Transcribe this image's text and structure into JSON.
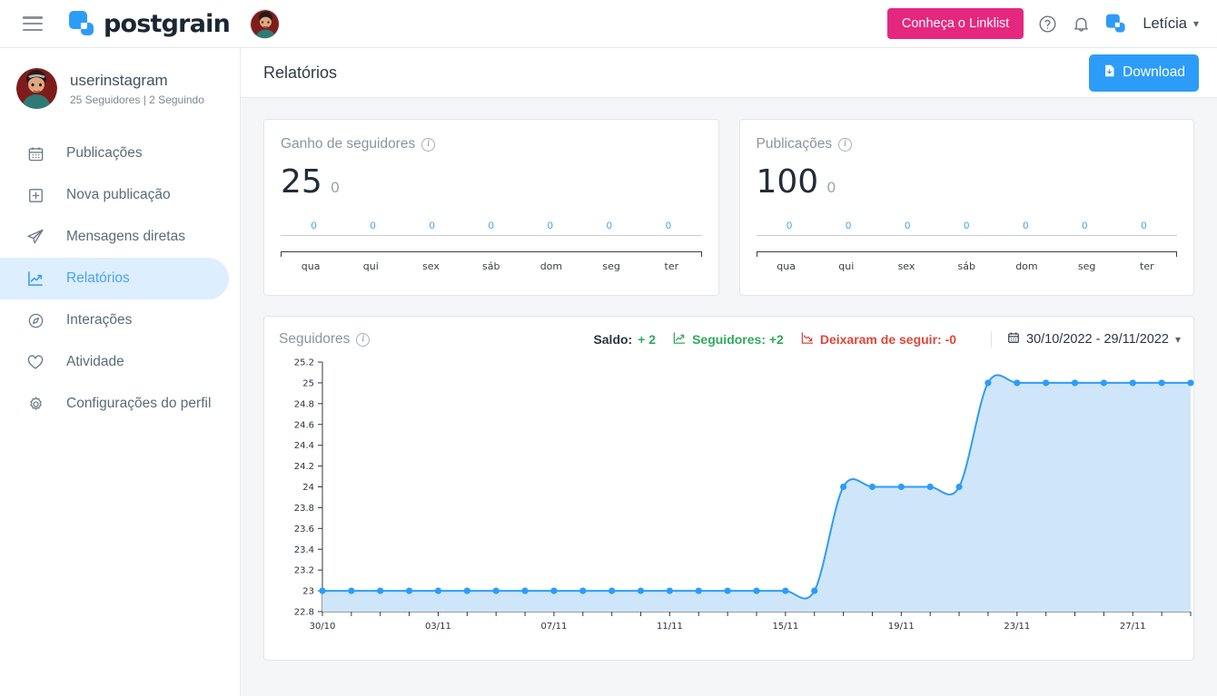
{
  "topbar": {
    "menu_icon": "hamburger-icon",
    "logo_text": "postgrain",
    "logo_icon": "postgrain-logo-icon",
    "account_avatar": "instagram-account-avatar",
    "linklist_button": "Conheça o Linklist",
    "help_icon": "help-circle-icon",
    "notifications_icon": "bell-icon",
    "app_icon": "postgrain-square-icon",
    "user_name": "Letícia",
    "user_chevron": "chevron-down-icon"
  },
  "sidebar": {
    "profile": {
      "name": "userinstagram",
      "stats": "25 Seguidores | 2 Seguindo",
      "avatar": "profile-avatar"
    },
    "items": [
      {
        "label": "Publicações",
        "icon": "calendar-icon",
        "active": false
      },
      {
        "label": "Nova publicação",
        "icon": "plus-square-icon",
        "active": false
      },
      {
        "label": "Mensagens diretas",
        "icon": "paper-plane-icon",
        "active": false
      },
      {
        "label": "Relatórios",
        "icon": "chart-line-icon",
        "active": true
      },
      {
        "label": "Interações",
        "icon": "compass-icon",
        "active": false
      },
      {
        "label": "Atividade",
        "icon": "heart-icon",
        "active": false
      },
      {
        "label": "Configurações do perfil",
        "icon": "gear-icon",
        "active": false
      }
    ]
  },
  "header": {
    "title": "Relatórios",
    "download_label": "Download",
    "download_icon": "file-download-icon"
  },
  "colors": {
    "accent_blue": "#2d9cf8",
    "brand_pink": "#e5277f",
    "active_nav_bg": "#ddeeff",
    "positive_green": "#2faa5b",
    "negative_red": "#e0453a",
    "chart_line": "#2d9cf8",
    "chart_fill": "#cfe6fa"
  },
  "cards": [
    {
      "title": "Ganho de seguidores",
      "info_icon": "info-icon",
      "value": "25",
      "delta": "0"
    },
    {
      "title": "Publicações",
      "info_icon": "info-icon",
      "value": "100",
      "delta": "0"
    }
  ],
  "mini_chart": {
    "values": [
      "0",
      "0",
      "0",
      "0",
      "0",
      "0",
      "0"
    ],
    "days": [
      "qua",
      "qui",
      "sex",
      "sáb",
      "dom",
      "seg",
      "ter"
    ]
  },
  "followers_panel": {
    "title": "Seguidores",
    "info_icon": "info-icon",
    "saldo_label": "Saldo:",
    "saldo_value": "+ 2",
    "gained_icon": "chart-line-up-icon",
    "gained_label": "Seguidores: +2",
    "lost_icon": "chart-line-down-icon",
    "lost_label": "Deixaram de seguir: -0",
    "calendar_icon": "calendar-icon",
    "date_range": "30/10/2022 - 29/11/2022",
    "chevron_icon": "chevron-down-icon"
  },
  "chart_data": {
    "type": "area",
    "title": "Seguidores",
    "xlabel": "",
    "ylabel": "",
    "ylim": [
      22.8,
      25.2
    ],
    "ytick_labels": [
      "25.2",
      "25",
      "24.8",
      "24.6",
      "24.4",
      "24.2",
      "24",
      "23.8",
      "23.6",
      "23.4",
      "23.2",
      "23",
      "22.8"
    ],
    "ytick_values": [
      25.2,
      25,
      24.8,
      24.6,
      24.4,
      24.2,
      24,
      23.8,
      23.6,
      23.4,
      23.2,
      23,
      22.8
    ],
    "xtick_labels": [
      "30/10",
      "03/11",
      "07/11",
      "11/11",
      "15/11",
      "19/11",
      "23/11",
      "27/11"
    ],
    "xtick_positions": [
      0,
      4,
      8,
      12,
      16,
      20,
      24,
      28
    ],
    "grid": false,
    "legend": "top-right",
    "x": [
      "30/10",
      "31/10",
      "01/11",
      "02/11",
      "03/11",
      "04/11",
      "05/11",
      "06/11",
      "07/11",
      "08/11",
      "09/11",
      "10/11",
      "11/11",
      "12/11",
      "13/11",
      "14/11",
      "15/11",
      "16/11",
      "17/11",
      "18/11",
      "19/11",
      "20/11",
      "21/11",
      "22/11",
      "23/11",
      "24/11",
      "25/11",
      "26/11",
      "27/11",
      "28/11",
      "29/11"
    ],
    "series": [
      {
        "name": "Seguidores",
        "values": [
          23,
          23,
          23,
          23,
          23,
          23,
          23,
          23,
          23,
          23,
          23,
          23,
          23,
          23,
          23,
          23,
          23,
          23,
          24,
          24,
          24,
          24,
          24,
          25,
          25,
          25,
          25,
          25,
          25,
          25,
          25
        ],
        "line_color": "#2d9cf8",
        "fill_color": "#cfe6fa",
        "marker": "circle"
      }
    ]
  }
}
